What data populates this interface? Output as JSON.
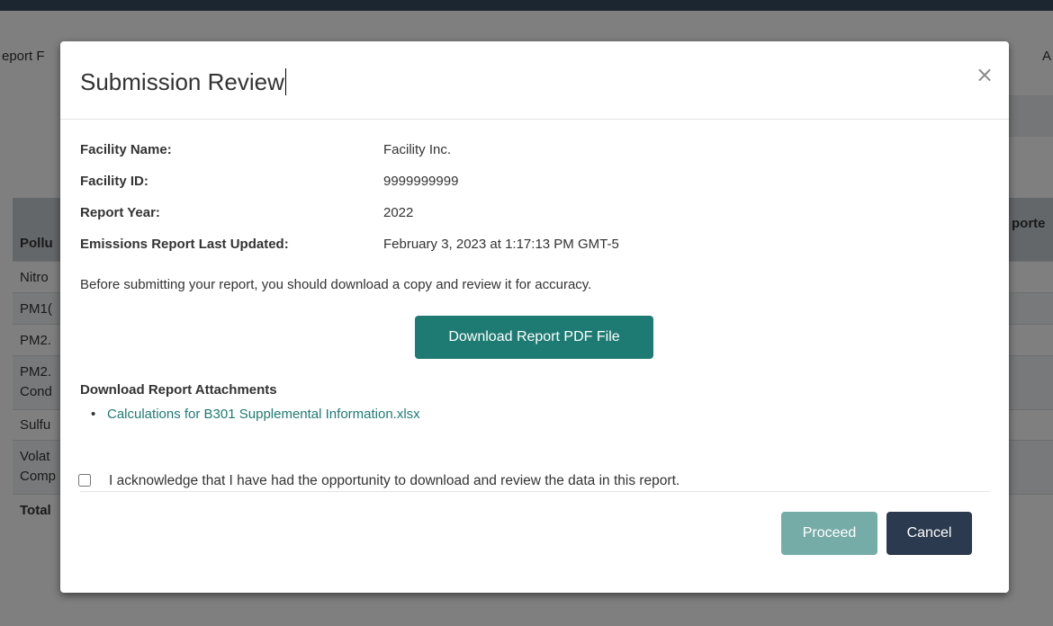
{
  "background": {
    "tab_left": "eport F",
    "tab_right": "A",
    "column_left": "Pollu",
    "column_right": "porte",
    "rows": [
      {
        "lines": [
          "Nitro"
        ]
      },
      {
        "lines": [
          "PM1("
        ]
      },
      {
        "lines": [
          "PM2."
        ]
      },
      {
        "lines": [
          "PM2.",
          "Cond"
        ]
      },
      {
        "lines": [
          "Sulfu"
        ]
      },
      {
        "lines": [
          "Volat",
          "Comp"
        ]
      },
      {
        "lines": [
          "Total"
        ]
      }
    ]
  },
  "modal": {
    "title": "Submission Review",
    "close_glyph": "×",
    "fields": [
      {
        "label": "Facility Name:",
        "value": "Facility Inc."
      },
      {
        "label": "Facility ID:",
        "value": "9999999999"
      },
      {
        "label": "Report Year:",
        "value": "2022"
      },
      {
        "label": "Emissions Report Last Updated:",
        "value": "February 3, 2023 at 1:17:13 PM GMT-5"
      }
    ],
    "instruction": "Before submitting your report, you should download a copy and review it for accuracy.",
    "download_pdf_label": "Download Report PDF File",
    "attachments_heading": "Download Report Attachments",
    "attachments": [
      "Calculations for B301 Supplemental Information.xlsx"
    ],
    "acknowledge_text": "I acknowledge that I have had the opportunity to download and review the data in this report.",
    "acknowledge_checked": false,
    "proceed_label": "Proceed",
    "cancel_label": "Cancel"
  },
  "colors": {
    "primary_teal": "#1e7b73",
    "proceed_disabled": "#76aca7",
    "cancel_dark": "#2b3a4e",
    "overlay": "rgba(0,0,0,0.5)"
  },
  "icons": {
    "close": "close-icon",
    "bullet": "bullet-icon",
    "checkbox": "checkbox-icon"
  }
}
